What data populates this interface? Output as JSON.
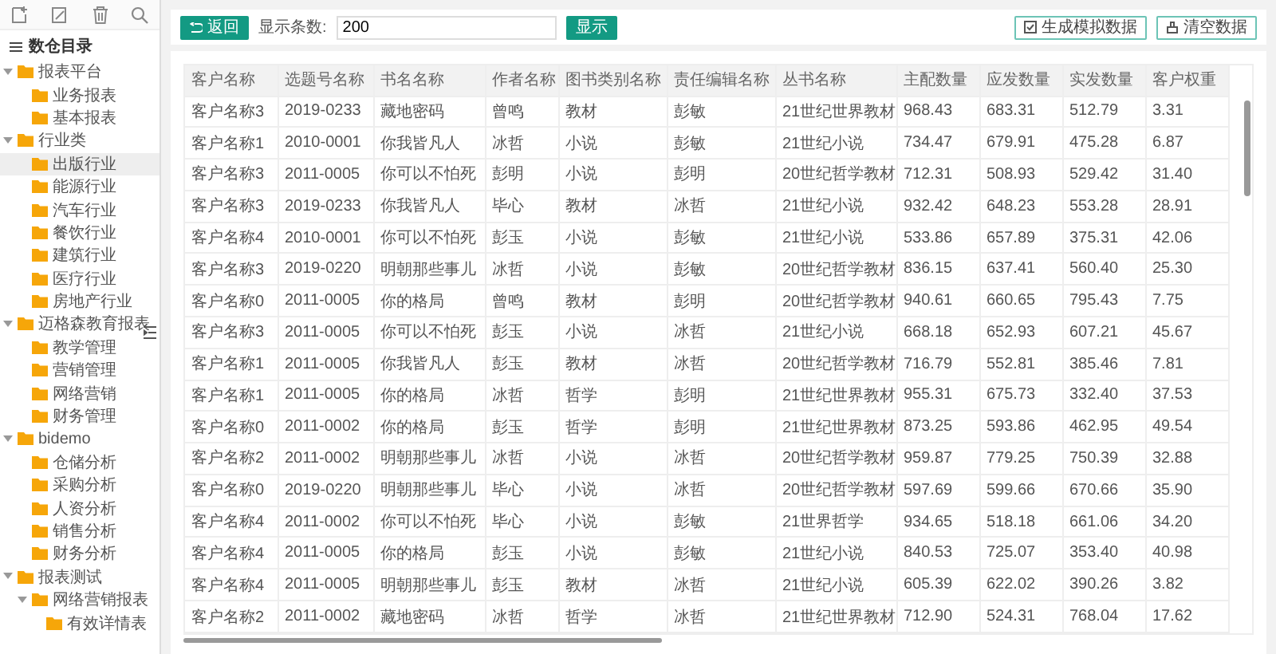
{
  "sidebar": {
    "title": "数仓目录",
    "tree": [
      {
        "label": "报表平台",
        "expanded": true,
        "selected": false,
        "children": [
          {
            "label": "业务报表",
            "selected": false
          },
          {
            "label": "基本报表",
            "selected": false
          }
        ]
      },
      {
        "label": "行业类",
        "expanded": true,
        "selected": false,
        "children": [
          {
            "label": "出版行业",
            "selected": true
          },
          {
            "label": "能源行业",
            "selected": false
          },
          {
            "label": "汽车行业",
            "selected": false
          },
          {
            "label": "餐饮行业",
            "selected": false
          },
          {
            "label": "建筑行业",
            "selected": false
          },
          {
            "label": "医疗行业",
            "selected": false
          },
          {
            "label": "房地产行业",
            "selected": false
          }
        ]
      },
      {
        "label": "迈格森教育报表",
        "expanded": true,
        "selected": false,
        "children": [
          {
            "label": "教学管理",
            "selected": false
          },
          {
            "label": "营销管理",
            "selected": false
          },
          {
            "label": "网络营销",
            "selected": false
          },
          {
            "label": "财务管理",
            "selected": false
          }
        ]
      },
      {
        "label": "bidemo",
        "expanded": true,
        "selected": false,
        "children": [
          {
            "label": "仓储分析",
            "selected": false
          },
          {
            "label": "采购分析",
            "selected": false
          },
          {
            "label": "人资分析",
            "selected": false
          },
          {
            "label": "销售分析",
            "selected": false
          },
          {
            "label": "财务分析",
            "selected": false
          }
        ]
      },
      {
        "label": "报表测试",
        "expanded": true,
        "selected": false,
        "children": [
          {
            "label": "网络营销报表",
            "expanded": true,
            "selected": false,
            "children": [
              {
                "label": "有效详情表",
                "selected": false
              }
            ]
          }
        ]
      }
    ]
  },
  "toolbar": {
    "back_button": "返回",
    "count_label": "显示条数:",
    "count_value": "200",
    "show_button": "显示",
    "generate_button": "生成模拟数据",
    "clear_button": "清空数据"
  },
  "table": {
    "columns": [
      "客户名称",
      "选题号名称",
      "书名名称",
      "作者名称",
      "图书类别名称",
      "责任编辑名称",
      "丛书名称",
      "主配数量",
      "应发数量",
      "实发数量",
      "客户权重"
    ],
    "rows": [
      [
        "客户名称3",
        "2019-0233",
        "藏地密码",
        "曾鸣",
        "教材",
        "彭敏",
        "21世纪世界教材",
        "968.43",
        "683.31",
        "512.79",
        "3.31"
      ],
      [
        "客户名称1",
        "2010-0001",
        "你我皆凡人",
        "冰哲",
        "小说",
        "彭敏",
        "21世纪小说",
        "734.47",
        "679.91",
        "475.28",
        "6.87"
      ],
      [
        "客户名称3",
        "2011-0005",
        "你可以不怕死",
        "彭明",
        "小说",
        "彭明",
        "20世纪哲学教材",
        "712.31",
        "508.93",
        "529.42",
        "31.40"
      ],
      [
        "客户名称3",
        "2019-0233",
        "你我皆凡人",
        "毕心",
        "教材",
        "冰哲",
        "21世纪小说",
        "932.42",
        "648.23",
        "553.28",
        "28.91"
      ],
      [
        "客户名称4",
        "2010-0001",
        "你可以不怕死",
        "彭玉",
        "小说",
        "彭敏",
        "21世纪小说",
        "533.86",
        "657.89",
        "375.31",
        "42.06"
      ],
      [
        "客户名称3",
        "2019-0220",
        "明朝那些事儿",
        "冰哲",
        "小说",
        "彭敏",
        "20世纪哲学教材",
        "836.15",
        "637.41",
        "560.40",
        "25.30"
      ],
      [
        "客户名称0",
        "2011-0005",
        "你的格局",
        "曾鸣",
        "教材",
        "彭明",
        "20世纪哲学教材",
        "940.61",
        "660.65",
        "795.43",
        "7.75"
      ],
      [
        "客户名称3",
        "2011-0005",
        "你可以不怕死",
        "彭玉",
        "小说",
        "冰哲",
        "21世纪小说",
        "668.18",
        "652.93",
        "607.21",
        "45.67"
      ],
      [
        "客户名称1",
        "2011-0005",
        "你我皆凡人",
        "彭玉",
        "教材",
        "冰哲",
        "20世纪哲学教材",
        "716.79",
        "552.81",
        "385.46",
        "7.81"
      ],
      [
        "客户名称1",
        "2011-0005",
        "你的格局",
        "冰哲",
        "哲学",
        "彭明",
        "21世纪世界教材",
        "955.31",
        "675.73",
        "332.40",
        "37.53"
      ],
      [
        "客户名称0",
        "2011-0002",
        "你的格局",
        "彭玉",
        "哲学",
        "彭明",
        "21世纪世界教材",
        "873.25",
        "593.86",
        "462.95",
        "49.54"
      ],
      [
        "客户名称2",
        "2011-0002",
        "明朝那些事儿",
        "冰哲",
        "小说",
        "冰哲",
        "20世纪哲学教材",
        "959.87",
        "779.25",
        "750.39",
        "32.88"
      ],
      [
        "客户名称0",
        "2019-0220",
        "明朝那些事儿",
        "毕心",
        "小说",
        "冰哲",
        "20世纪哲学教材",
        "597.69",
        "599.66",
        "670.66",
        "35.90"
      ],
      [
        "客户名称4",
        "2011-0002",
        "你可以不怕死",
        "毕心",
        "小说",
        "彭敏",
        "21世界哲学",
        "934.65",
        "518.18",
        "661.06",
        "34.20"
      ],
      [
        "客户名称4",
        "2011-0005",
        "你的格局",
        "彭玉",
        "小说",
        "彭敏",
        "21世纪小说",
        "840.53",
        "725.07",
        "353.40",
        "40.98"
      ],
      [
        "客户名称4",
        "2011-0005",
        "明朝那些事儿",
        "彭玉",
        "教材",
        "冰哲",
        "21世纪小说",
        "605.39",
        "622.02",
        "390.26",
        "3.82"
      ],
      [
        "客户名称2",
        "2011-0002",
        "藏地密码",
        "冰哲",
        "哲学",
        "冰哲",
        "21世纪世界教材",
        "712.90",
        "524.31",
        "768.04",
        "17.62"
      ]
    ]
  }
}
